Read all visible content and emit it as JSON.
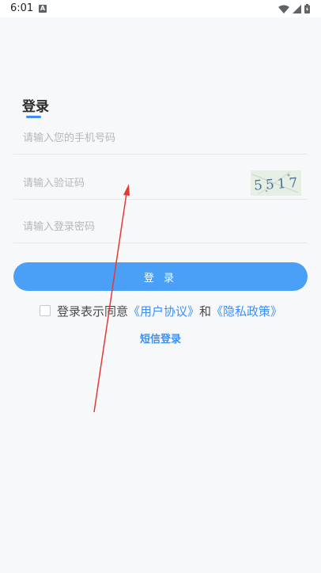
{
  "status_bar": {
    "time": "6:01",
    "app_icon_letter": "A",
    "icons": [
      "wifi-icon",
      "signal-icon",
      "battery-icon"
    ]
  },
  "login": {
    "title": "登录",
    "phone_placeholder": "请输入您的手机号码",
    "code_placeholder": "请输入验证码",
    "password_placeholder": "请输入登录密码",
    "captcha_text": "5517",
    "button_label": "登 录",
    "agreement": {
      "prefix": "登录表示同意",
      "user_agreement": "《用户协议》",
      "and": "和",
      "privacy_policy": "《隐私政策》",
      "checked": false
    },
    "sms_login": "短信登录"
  },
  "colors": {
    "accent": "#3d8ff7",
    "button": "#4aa0f7",
    "annotation_arrow": "#e53935"
  }
}
